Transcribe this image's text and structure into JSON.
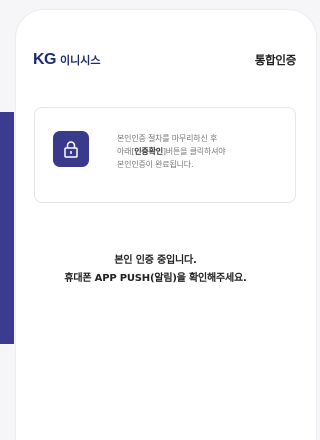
{
  "header": {
    "logo_mark": "KG",
    "logo_name": "이니시스",
    "title": "통합인증"
  },
  "info": {
    "icon": "lock-icon",
    "line1": "본인인증 절차를 마무리하신 후",
    "line2_prefix": "아래[",
    "line2_bold": "인증확인",
    "line2_suffix": "]버튼을 클릭하셔야",
    "line3": "본인인증이 완료됩니다."
  },
  "message": {
    "line1": "본인 인증 중입니다.",
    "line2": "휴대폰 APP PUSH(알림)을 확인해주세요."
  },
  "colors": {
    "brand": "#1f2b6c",
    "accent": "#3a3a8c"
  }
}
